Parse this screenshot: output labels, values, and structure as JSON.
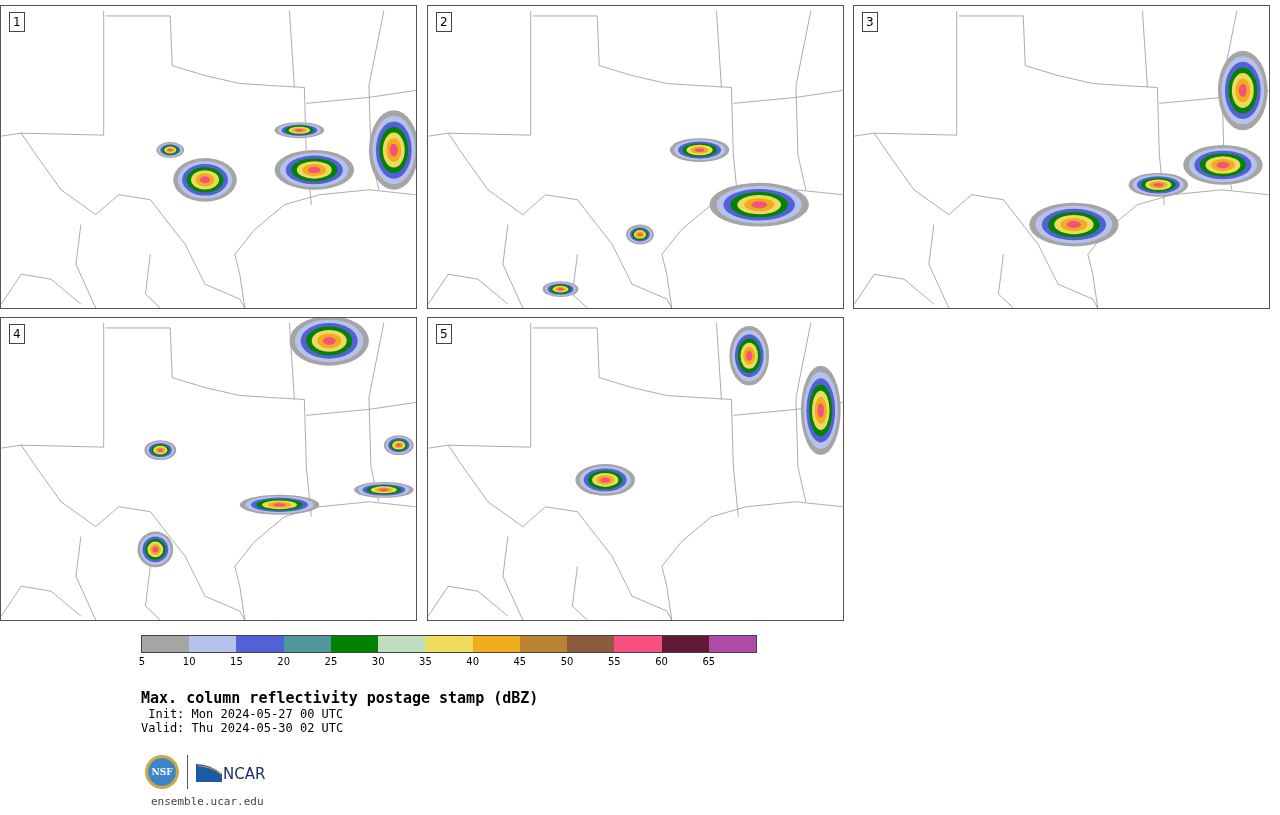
{
  "panels": [
    {
      "label": "1"
    },
    {
      "label": "2"
    },
    {
      "label": "3"
    },
    {
      "label": "4"
    },
    {
      "label": "5"
    }
  ],
  "colorbar": {
    "bins": [
      {
        "color": "#a5a5a5"
      },
      {
        "color": "#b7c2ec"
      },
      {
        "color": "#5261d6"
      },
      {
        "color": "#50979b"
      },
      {
        "color": "#018201"
      },
      {
        "color": "#bedfbe"
      },
      {
        "color": "#efd95f"
      },
      {
        "color": "#efac1d"
      },
      {
        "color": "#ba8333"
      },
      {
        "color": "#8c5b3e"
      },
      {
        "color": "#f5507e"
      },
      {
        "color": "#621937"
      },
      {
        "color": "#ad4ba6"
      }
    ],
    "ticks": [
      "5",
      "10",
      "15",
      "20",
      "25",
      "30",
      "35",
      "40",
      "45",
      "50",
      "55",
      "60",
      "65"
    ]
  },
  "title": "Max. column reflectivity postage stamp (dBZ)",
  "init": " Init: Mon 2024-05-27 00 UTC",
  "valid": "Valid: Thu 2024-05-30 02 UTC",
  "logos": [
    {
      "text": "NSF"
    },
    {
      "text": "NCAR"
    }
  ],
  "url": "ensemble.ucar.edu"
}
